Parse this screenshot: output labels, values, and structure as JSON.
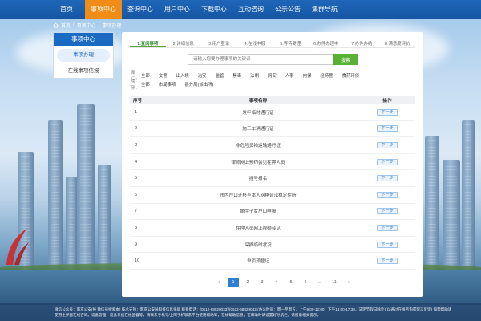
{
  "nav": {
    "items": [
      {
        "label": "首页",
        "active": false
      },
      {
        "label": "事项中心",
        "active": true
      },
      {
        "label": "查询中心",
        "active": false
      },
      {
        "label": "用户中心",
        "active": false
      },
      {
        "label": "下载中心",
        "active": false
      },
      {
        "label": "互动咨询",
        "active": false
      },
      {
        "label": "公示公告",
        "active": false
      },
      {
        "label": "集群导航",
        "active": false
      }
    ]
  },
  "breadcrumb": {
    "items": [
      "首页",
      "事项中心",
      "事项办理"
    ],
    "separator": "/"
  },
  "sidebar": {
    "title": "事项中心",
    "items": [
      {
        "label": "事项办理",
        "active": true
      },
      {
        "label": "在线事项信报",
        "active": false
      }
    ]
  },
  "steps": [
    {
      "label": "1.查阅事项",
      "active": true
    },
    {
      "label": "2.详细信息",
      "active": false
    },
    {
      "label": "3.用户登录",
      "active": false
    },
    {
      "label": "4.在线申报",
      "active": false
    },
    {
      "label": "5.等待受理",
      "active": false
    },
    {
      "label": "6.办件办理中",
      "active": false
    },
    {
      "label": "7.办件办结",
      "active": false
    },
    {
      "label": "8.满意度评价",
      "active": false
    }
  ],
  "search": {
    "placeholder": "请输入您要办理事项的关键词",
    "button_label": "搜索"
  },
  "filters": {
    "dept": {
      "label": "部门:",
      "options": [
        "全部",
        "交警",
        "出入境",
        "治安",
        "监管",
        "禁毒",
        "法制",
        "网安",
        "人事",
        "内保",
        "经特警",
        "食药环侦"
      ]
    },
    "category": {
      "label": "类别:",
      "options": [
        "全部",
        "市局事项",
        "县分局(派出所)"
      ]
    }
  },
  "table": {
    "headers": {
      "no": "序号",
      "name": "事项名称",
      "op": "操作"
    },
    "op_label": "下一步",
    "rows": [
      {
        "no": "1",
        "name": "发牢临时通行证"
      },
      {
        "no": "2",
        "name": "施工车辆通行证"
      },
      {
        "no": "3",
        "name": "非危险货物运输通行证"
      },
      {
        "no": "4",
        "name": "律师网上预约会见在押人员"
      },
      {
        "no": "5",
        "name": "摇号报名"
      },
      {
        "no": "6",
        "name": "市内户口迁移至本人网格合法稳定住所"
      },
      {
        "no": "7",
        "name": "婚生子女户口申报"
      },
      {
        "no": "8",
        "name": "在押人员网上视频会见"
      },
      {
        "no": "9",
        "name": "采摘临时状况"
      },
      {
        "no": "10",
        "name": "单页预登记"
      }
    ]
  },
  "pagination": {
    "prev": "‹",
    "pages": [
      "1",
      "2",
      "3",
      "4",
      "5",
      "6",
      "...",
      "11"
    ],
    "current": "1",
    "next": "›"
  },
  "footer": {
    "line1": "微信公众号：南京公安(按 微信号搜索本)  技术支持：南京公安局科技信息化处  联系电话：(0512-68820033)/(0512-68820043)(办公时间：周一至周五，上午9:00-12:00，下午13:00-17:30，法定节假日除外)(以通过在线咨询或留言反馈)  如需帮助请",
    "line2": "使用主界面在线咨询。设备管理，设备系统在线监督等，请联系手机号/上网手机联系平台使用帮助等，在线帮助信息，在帮助时请设置好导航栏，请留意相关提示。"
  },
  "colors": {
    "nav_bg": "#1656a3",
    "nav_active": "#f18c17",
    "accent_green": "#58b035",
    "accent_blue": "#2f7fd1"
  }
}
